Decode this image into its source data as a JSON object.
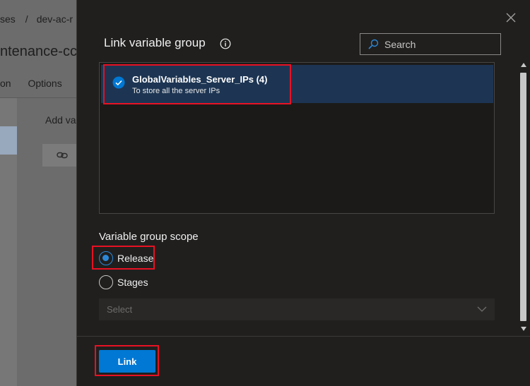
{
  "background": {
    "breadcrumb": [
      "ses",
      "dev-ac-r"
    ],
    "breadcrumb_sep": "/",
    "title": "ntenance-cc",
    "tabs": [
      "on",
      "Options"
    ],
    "add_variable": "Add va",
    "link_icon": "link-icon"
  },
  "panel": {
    "title": "Link variable group",
    "info_icon": "info-icon",
    "close_icon": "close-icon",
    "search": {
      "placeholder": "Search",
      "value": ""
    },
    "variable_groups": [
      {
        "name": "GlobalVariables_Server_IPs (4)",
        "description": "To store all the server IPs",
        "selected": true
      }
    ],
    "scope": {
      "label": "Variable group scope",
      "options": [
        {
          "label": "Release",
          "selected": true
        },
        {
          "label": "Stages",
          "selected": false
        }
      ],
      "stage_select_placeholder": "Select"
    },
    "link_button": "Link"
  },
  "colors": {
    "accent": "#0078d4",
    "selected_row": "#1d3553",
    "highlight_annotation": "#e81123",
    "panel_bg": "#201f1e"
  }
}
